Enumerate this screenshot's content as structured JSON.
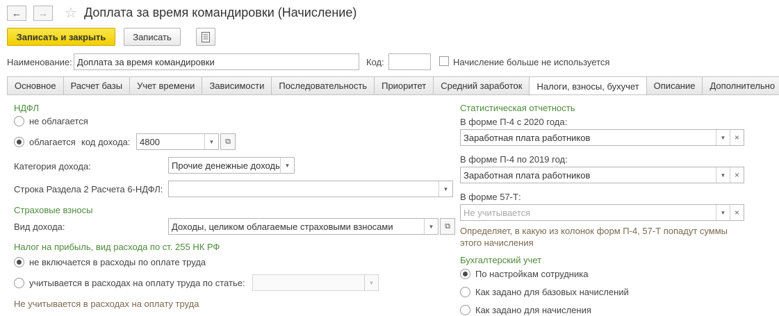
{
  "window": {
    "title": "Доплата за время командировки (Начисление)"
  },
  "toolbar": {
    "save_close": "Записать и закрыть",
    "save": "Записать"
  },
  "header": {
    "name_label": "Наименование:",
    "name_value": "Доплата за время командировки",
    "code_label": "Код:",
    "code_value": "",
    "not_used_label": "Начисление больше не используется"
  },
  "tabs": [
    "Основное",
    "Расчет базы",
    "Учет времени",
    "Зависимости",
    "Последовательность",
    "Приоритет",
    "Средний заработок",
    "Налоги, взносы, бухучет",
    "Описание",
    "Дополнительно"
  ],
  "ndfl": {
    "section": "НДФЛ",
    "not_taxed": "не облагается",
    "taxed": "облагается",
    "income_code_label": "код дохода:",
    "income_code_value": "4800",
    "category_label": "Категория дохода:",
    "category_value": "Прочие денежные доходы",
    "row6_label": "Строка Раздела 2 Расчета 6-НДФЛ:",
    "row6_value": ""
  },
  "insurance": {
    "section": "Страховые взносы",
    "kind_label": "Вид дохода:",
    "kind_value": "Доходы, целиком облагаемые страховыми взносами"
  },
  "profit_tax": {
    "section": "Налог на прибыль, вид расхода по ст. 255 НК РФ",
    "not_included": "не включается в расходы по оплате труда",
    "included_by_article": "учитывается в расходах на оплату труда по статье:",
    "article_value": "",
    "hint": "Не учитывается в расходах на оплату труда"
  },
  "stats": {
    "section": "Статистическая отчетность",
    "p4_2020_label": "В форме П-4 с 2020 года:",
    "p4_2020_value": "Заработная плата работников",
    "p4_2019_label": "В форме П-4 по 2019 год:",
    "p4_2019_value": "Заработная плата работников",
    "f57t_label": "В форме 57-Т:",
    "f57t_placeholder": "Не учитывается",
    "hint_line1": "Определяет, в какую из колонок форм П-4, 57-Т попадут суммы",
    "hint_line2": "этого начисления"
  },
  "accounting": {
    "section": "Бухгалтерский учет",
    "opt1": "По настройкам сотрудника",
    "opt2": "Как задано для базовых начислений",
    "opt3": "Как задано для начисления"
  }
}
